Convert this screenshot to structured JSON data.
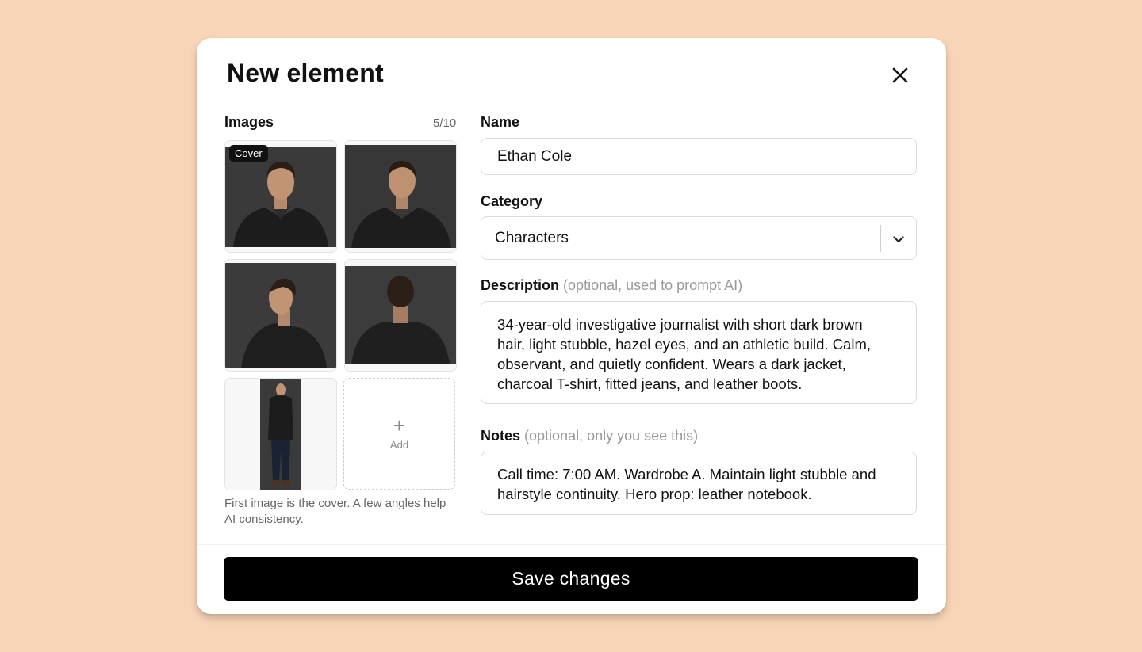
{
  "modal": {
    "title": "New element",
    "close_icon": "close-icon"
  },
  "images": {
    "label": "Images",
    "count": "5/10",
    "cover_badge": "Cover",
    "add_label": "Add",
    "add_icon": "plus-icon",
    "caption": "First image is the cover. A few angles help AI consistency.",
    "thumbnails": [
      {
        "alt": "front portrait"
      },
      {
        "alt": "three-quarter portrait"
      },
      {
        "alt": "profile portrait"
      },
      {
        "alt": "back view"
      },
      {
        "alt": "full body"
      }
    ]
  },
  "form": {
    "name": {
      "label": "Name",
      "value": "Ethan Cole"
    },
    "category": {
      "label": "Category",
      "value": "Characters",
      "icon": "chevron-down-icon"
    },
    "description": {
      "label": "Description",
      "hint": "(optional, used to prompt AI)",
      "value": "34-year-old investigative journalist with short dark brown hair, light stubble, hazel eyes, and an athletic build. Calm, observant, and quietly confident. Wears a dark jacket, charcoal T-shirt, fitted jeans, and leather boots."
    },
    "notes": {
      "label": "Notes",
      "hint": "(optional, only you see this)",
      "value": "Call time: 7:00 AM. Wardrobe A. Maintain light stubble and hairstyle continuity. Hero prop: leather notebook."
    }
  },
  "footer": {
    "save_label": "Save changes"
  },
  "colors": {
    "background": "#f8d5b7",
    "primary_button": "#000000"
  }
}
